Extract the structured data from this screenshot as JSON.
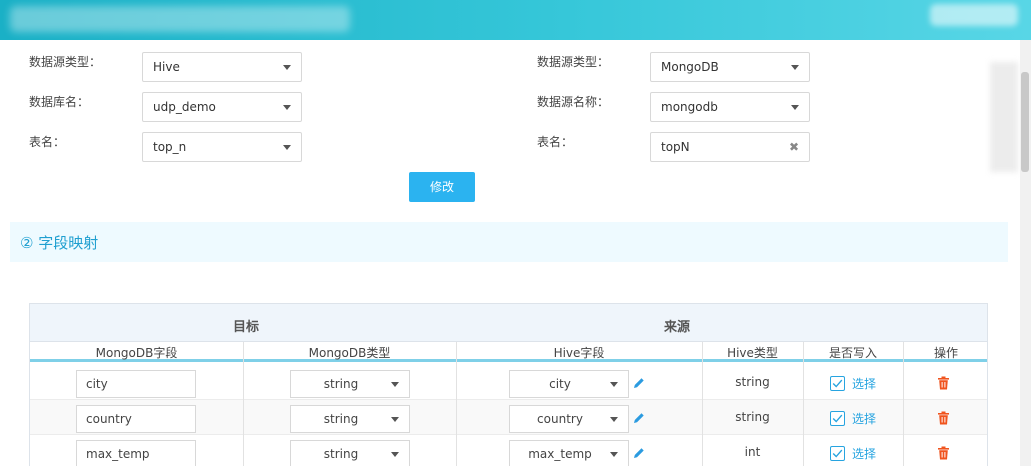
{
  "source": {
    "type_label": "数据源类型：",
    "type_value": "Hive",
    "db_label": "数据库名：",
    "db_value": "udp_demo",
    "table_label": "表名：",
    "table_value": "top_n"
  },
  "target": {
    "type_label": "数据源类型：",
    "type_value": "MongoDB",
    "name_label": "数据源名称：",
    "name_value": "mongodb",
    "table_label": "表名：",
    "table_value": "topN"
  },
  "modify_button": "修改",
  "section_title": "② 字段映射",
  "mapping": {
    "group_target": "目标",
    "group_source": "来源",
    "columns": [
      "MongoDB字段",
      "MongoDB类型",
      "Hive字段",
      "Hive类型",
      "是否写入",
      "操作"
    ],
    "select_label": "选择",
    "rows": [
      {
        "mongo_field": "city",
        "mongo_type": "string",
        "hive_field": "city",
        "hive_type": "string"
      },
      {
        "mongo_field": "country",
        "mongo_type": "string",
        "hive_field": "country",
        "hive_type": "string"
      },
      {
        "mongo_field": "max_temp",
        "mongo_type": "string",
        "hive_field": "max_temp",
        "hive_type": "int"
      }
    ]
  },
  "colors": {
    "accent": "#2bb3f0",
    "header_bar": "#1ab0c6",
    "delete": "#f0541e"
  }
}
